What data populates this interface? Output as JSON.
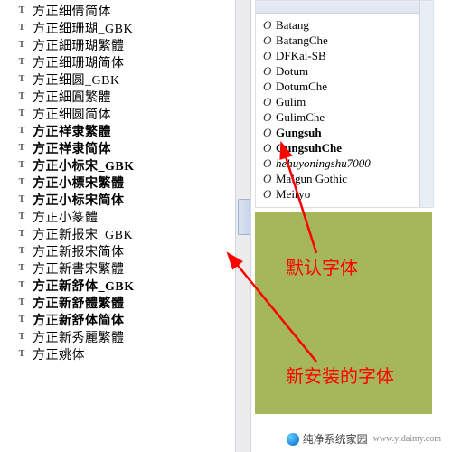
{
  "leftFonts": [
    {
      "name": "方正细倩简体",
      "bold": false
    },
    {
      "name": "方正细珊瑚_GBK",
      "bold": false
    },
    {
      "name": "方正細珊瑚繁體",
      "bold": false
    },
    {
      "name": "方正细珊瑚简体",
      "bold": false
    },
    {
      "name": "方正细圆_GBK",
      "bold": false
    },
    {
      "name": "方正細圓繁體",
      "bold": false
    },
    {
      "name": "方正细圆简体",
      "bold": false
    },
    {
      "name": "方正祥隶繁體",
      "bold": true
    },
    {
      "name": "方正祥隶简体",
      "bold": true
    },
    {
      "name": "方正小标宋_GBK",
      "bold": true
    },
    {
      "name": "方正小標宋繁體",
      "bold": true
    },
    {
      "name": "方正小标宋简体",
      "bold": true
    },
    {
      "name": "方正小篆體",
      "bold": false
    },
    {
      "name": "方正新报宋_GBK",
      "bold": false
    },
    {
      "name": "方正新报宋简体",
      "bold": false
    },
    {
      "name": "方正新書宋繁體",
      "bold": false
    },
    {
      "name": "方正新舒体_GBK",
      "bold": true
    },
    {
      "name": "方正新舒體繁體",
      "bold": true
    },
    {
      "name": "方正新舒体简体",
      "bold": true
    },
    {
      "name": "方正新秀麗繁體",
      "bold": false
    },
    {
      "name": "方正姚体",
      "bold": false
    }
  ],
  "rightFonts": [
    {
      "name": "Batang",
      "bold": false,
      "script": false
    },
    {
      "name": "BatangChe",
      "bold": false,
      "script": false
    },
    {
      "name": "DFKai-SB",
      "bold": false,
      "script": false
    },
    {
      "name": "Dotum",
      "bold": false,
      "script": false
    },
    {
      "name": "DotumChe",
      "bold": false,
      "script": false
    },
    {
      "name": "Gulim",
      "bold": false,
      "script": false
    },
    {
      "name": "GulimChe",
      "bold": false,
      "script": false
    },
    {
      "name": "Gungsuh",
      "bold": true,
      "script": false
    },
    {
      "name": "GungsuhChe",
      "bold": true,
      "script": false
    },
    {
      "name": "hehuyoningshu7000",
      "bold": false,
      "script": true
    },
    {
      "name": "Malgun Gothic",
      "bold": false,
      "script": false
    },
    {
      "name": "Meiryo",
      "bold": false,
      "script": false
    }
  ],
  "annotations": {
    "label1": "默认字体",
    "label2": "新安装的字体"
  },
  "watermark": {
    "brand": "纯净系统家园",
    "url": "www.yidaimy.com"
  }
}
